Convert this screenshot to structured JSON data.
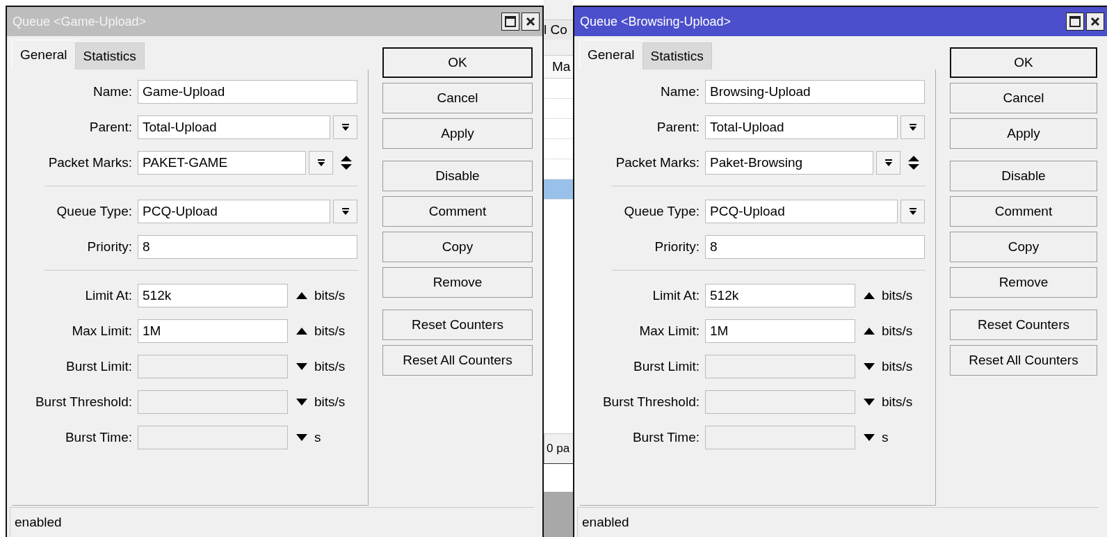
{
  "windows": [
    {
      "title": "Queue <Game-Upload>",
      "active": false,
      "tabs": [
        {
          "label": "General",
          "selected": true
        },
        {
          "label": "Statistics",
          "selected": false
        }
      ],
      "field_groups": [
        [
          {
            "kind": "text",
            "label": "Name:",
            "value": "Game-Upload"
          },
          {
            "kind": "dropdown",
            "label": "Parent:",
            "value": "Total-Upload"
          },
          {
            "kind": "multi",
            "label": "Packet Marks:",
            "value": "PAKET-GAME"
          }
        ],
        [
          {
            "kind": "dropdown",
            "label": "Queue Type:",
            "value": "PCQ-Upload"
          },
          {
            "kind": "text",
            "label": "Priority:",
            "value": "8"
          }
        ],
        [
          {
            "kind": "limit",
            "label": "Limit At:",
            "value": "512k",
            "expanded": true,
            "unit": "bits/s"
          },
          {
            "kind": "limit",
            "label": "Max Limit:",
            "value": "1M",
            "expanded": true,
            "unit": "bits/s"
          },
          {
            "kind": "limit",
            "label": "Burst Limit:",
            "expanded": false,
            "unit": "bits/s"
          },
          {
            "kind": "limit",
            "label": "Burst Threshold:",
            "expanded": false,
            "unit": "bits/s"
          },
          {
            "kind": "limit",
            "label": "Burst Time:",
            "expanded": false,
            "unit": "s"
          }
        ]
      ],
      "button_groups": [
        [
          {
            "label": "OK",
            "default": true
          },
          {
            "label": "Cancel",
            "default": false
          },
          {
            "label": "Apply",
            "default": false
          }
        ],
        [
          {
            "label": "Disable",
            "default": false
          },
          {
            "label": "Comment",
            "default": false
          },
          {
            "label": "Copy",
            "default": false
          },
          {
            "label": "Remove",
            "default": false
          }
        ],
        [
          {
            "label": "Reset Counters",
            "default": false
          },
          {
            "label": "Reset All Counters",
            "default": false
          }
        ]
      ],
      "status": "enabled"
    },
    {
      "title": "Queue <Browsing-Upload>",
      "active": true,
      "tabs": [
        {
          "label": "General",
          "selected": true
        },
        {
          "label": "Statistics",
          "selected": false
        }
      ],
      "field_groups": [
        [
          {
            "kind": "text",
            "label": "Name:",
            "value": "Browsing-Upload"
          },
          {
            "kind": "dropdown",
            "label": "Parent:",
            "value": "Total-Upload"
          },
          {
            "kind": "multi",
            "label": "Packet Marks:",
            "value": "Paket-Browsing"
          }
        ],
        [
          {
            "kind": "dropdown",
            "label": "Queue Type:",
            "value": "PCQ-Upload"
          },
          {
            "kind": "text",
            "label": "Priority:",
            "value": "8"
          }
        ],
        [
          {
            "kind": "limit",
            "label": "Limit At:",
            "value": "512k",
            "expanded": true,
            "unit": "bits/s"
          },
          {
            "kind": "limit",
            "label": "Max Limit:",
            "value": "1M",
            "expanded": true,
            "unit": "bits/s"
          },
          {
            "kind": "limit",
            "label": "Burst Limit:",
            "expanded": false,
            "unit": "bits/s"
          },
          {
            "kind": "limit",
            "label": "Burst Threshold:",
            "expanded": false,
            "unit": "bits/s"
          },
          {
            "kind": "limit",
            "label": "Burst Time:",
            "expanded": false,
            "unit": "s"
          }
        ]
      ],
      "button_groups": [
        [
          {
            "label": "OK",
            "default": true
          },
          {
            "label": "Cancel",
            "default": false
          },
          {
            "label": "Apply",
            "default": false
          }
        ],
        [
          {
            "label": "Disable",
            "default": false
          },
          {
            "label": "Comment",
            "default": false
          },
          {
            "label": "Copy",
            "default": false
          },
          {
            "label": "Remove",
            "default": false
          }
        ],
        [
          {
            "label": "Reset Counters",
            "default": false
          },
          {
            "label": "Reset All Counters",
            "default": false
          }
        ]
      ],
      "status": "enabled"
    }
  ],
  "background_window": {
    "tab": "l Co",
    "column": "Ma",
    "rows": [
      {
        "selected": false
      },
      {
        "selected": false
      },
      {
        "selected": false
      },
      {
        "selected": false
      },
      {
        "selected": false
      },
      {
        "selected": true
      }
    ],
    "status": "0 pa"
  }
}
